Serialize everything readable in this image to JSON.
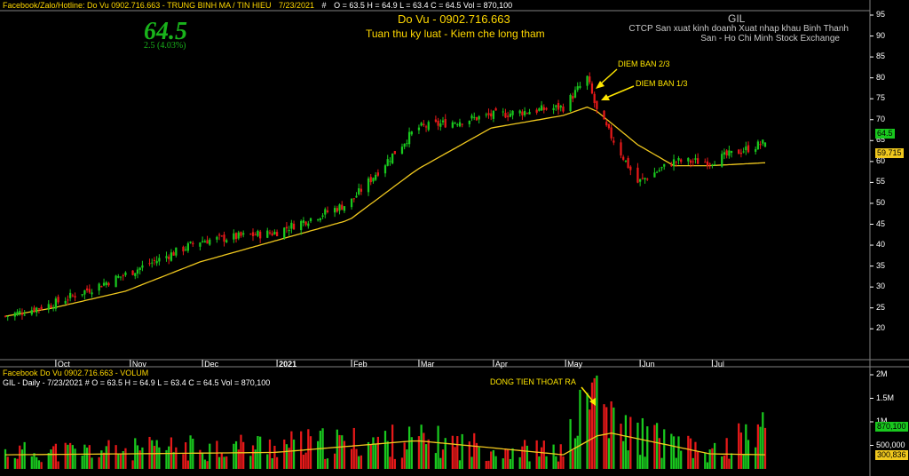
{
  "header": {
    "source": "Facebook/Zalo/Hotline: Do Vu 0902.716.663 - TRUNG BINH MA / TIN HIEU",
    "date": "7/23/2021",
    "hash": "#",
    "ohlc": "O = 63.5  H = 64.9  L = 63.4  C = 64.5  Vol = 870,100"
  },
  "price_box": {
    "last": "64.5",
    "change": "2.5  (4.03%)"
  },
  "author": {
    "name": "Do Vu - 0902.716.663",
    "motto": "Tuan thu ky luat - Kiem che long tham"
  },
  "stock": {
    "symbol": "GIL",
    "desc_1": "CTCP San xuat kinh doanh Xuat nhap khau Binh Thanh",
    "desc_2": "San - Ho Chi Minh Stock Exchange"
  },
  "annotations": {
    "sell_2_3": "DIEM BAN 2/3",
    "sell_1_3": "DIEM BAN 1/3",
    "money_out": "DONG TIEN THOAT RA"
  },
  "value_tags": {
    "last_price": "64.5",
    "ma_price": "59.715",
    "last_volume": "870,100",
    "ma_volume": "300,836"
  },
  "volume_header": {
    "title": "Facebook Do Vu 0902.716.663 - VOLUM",
    "line": "GIL - Daily - 7/23/2021  #  O = 63.5  H = 64.9  L = 63.4  C = 64.5  Vol = 870,100"
  },
  "colors": {
    "up": "#19c81e",
    "down": "#e61919",
    "ma": "#f0c81e",
    "background": "#000000",
    "grid": "#7f7f7f"
  },
  "chart_data": [
    {
      "type": "candlestick",
      "title": "GIL",
      "ylim": [
        18,
        95
      ],
      "y_ticks": [
        "20",
        "25",
        "30",
        "35",
        "40",
        "45",
        "50",
        "55",
        "60",
        "65",
        "70",
        "75",
        "80",
        "85",
        "90",
        "95"
      ],
      "x_ticks": [
        "Oct",
        "Nov",
        "Dec",
        "2021",
        "Feb",
        "Mar",
        "Apr",
        "May",
        "Jun",
        "Jul"
      ],
      "grid": false,
      "key_points": {
        "dates": [
          "2020-09-10",
          "2020-09-30",
          "2020-10-30",
          "2020-11-30",
          "2020-12-31",
          "2021-01-31",
          "2021-02-28",
          "2021-03-31",
          "2021-04-30",
          "2021-05-10",
          "2021-05-14",
          "2021-05-31",
          "2021-06-15",
          "2021-06-30",
          "2021-07-23"
        ],
        "close": [
          23,
          26,
          33,
          41,
          43,
          50,
          68,
          71,
          73,
          80,
          72,
          55,
          60,
          60,
          64.5
        ],
        "ma": [
          23,
          25,
          29,
          36,
          41,
          46,
          58,
          68,
          71,
          73,
          72,
          64,
          59,
          59,
          59.7
        ]
      },
      "last": {
        "date": "7/23/2021",
        "open": 63.5,
        "high": 64.9,
        "low": 63.4,
        "close": 64.5
      },
      "ma_last": 59.715
    },
    {
      "type": "bar",
      "title": "VOLUM",
      "y_ticks": [
        "500,000",
        "1M",
        "1.5M",
        "2M"
      ],
      "key_points": {
        "dates": [
          "2020-09-10",
          "2020-10-31",
          "2020-12-31",
          "2021-02-28",
          "2021-03-31",
          "2021-04-30",
          "2021-05-14",
          "2021-05-20",
          "2021-06-30",
          "2021-07-23"
        ],
        "volume": [
          350000,
          400000,
          500000,
          600000,
          450000,
          350000,
          1800000,
          900000,
          300000,
          870100
        ],
        "ma": [
          300000,
          320000,
          350000,
          600000,
          450000,
          300000,
          700000,
          760000,
          320000,
          300836
        ]
      },
      "last_volume": 870100,
      "ma_last": 300836
    }
  ]
}
